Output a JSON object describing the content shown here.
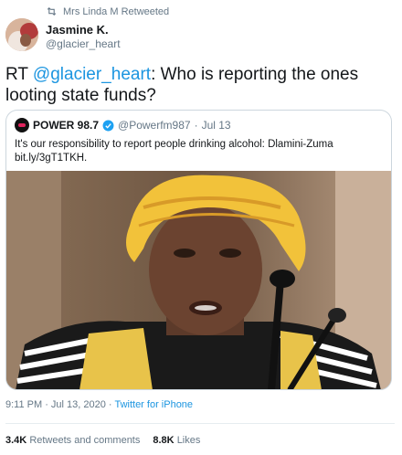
{
  "retweet": {
    "text": "Mrs Linda  M Retweeted",
    "icon": "retweet-icon"
  },
  "tweet": {
    "author_name": "Jasmine K.",
    "author_handle": "@glacier_heart",
    "text_prefix": "RT ",
    "text_mention": "@glacier_heart",
    "text_body": ": Who is reporting the ones looting state funds?",
    "timestamp": "9:11 PM · Jul 13, 2020",
    "separator": " · ",
    "source": "Twitter for iPhone",
    "mention_color": "#1b95e0"
  },
  "quoted": {
    "name": "POWER 98.7",
    "handle": "@Powerfm987",
    "separator": "·",
    "date": "Jul 13",
    "text_line1": "It's our responsibility to report people drinking alcohol: Dlamini-Zuma",
    "text_line2": "bit.ly/3gT1TKH."
  },
  "stats": {
    "retweets_count": "3.4K",
    "retweets_label": "Retweets and comments",
    "likes_count": "8.8K",
    "likes_label": "Likes"
  }
}
